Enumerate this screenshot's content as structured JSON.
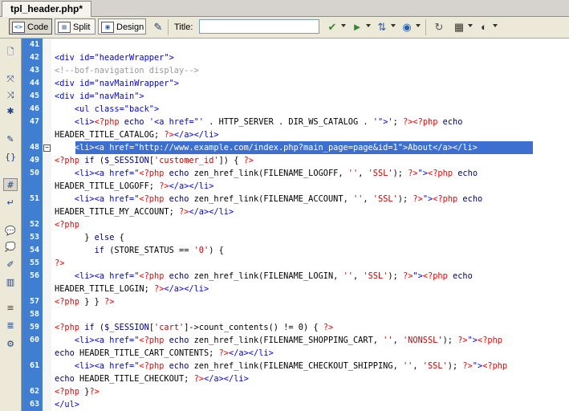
{
  "tab": {
    "label": "tpl_header.php*"
  },
  "toolbar": {
    "code_label": "Code",
    "split_label": "Split",
    "design_label": "Design",
    "title_label": "Title:",
    "title_value": ""
  },
  "lines": [
    {
      "num": "41",
      "parts": []
    },
    {
      "num": "42",
      "parts": [
        {
          "c": "t",
          "t": "<div id=\"headerWrapper\">"
        }
      ]
    },
    {
      "num": "43",
      "parts": [
        {
          "c": "c",
          "t": "<!--bof-navigation display-->"
        }
      ]
    },
    {
      "num": "44",
      "parts": [
        {
          "c": "t",
          "t": "<div id=\"navMainWrapper\">"
        }
      ]
    },
    {
      "num": "45",
      "parts": [
        {
          "c": "t",
          "t": "<div id=\"navMain\">"
        }
      ]
    },
    {
      "num": "46",
      "parts": [
        {
          "c": "t",
          "t": "    <ul class=\"back\">"
        }
      ]
    },
    {
      "num": "47",
      "parts": [
        {
          "c": "t",
          "t": "    <li>"
        },
        {
          "c": "p",
          "t": "<?php"
        },
        {
          "c": "k",
          "t": " echo "
        },
        {
          "c": "t",
          "t": "'<a href=\"'"
        },
        {
          "c": "f",
          "t": " . HTTP_SERVER . DIR_WS_CATALOG . "
        },
        {
          "c": "t",
          "t": "'\">'"
        },
        {
          "c": "f",
          "t": "; "
        },
        {
          "c": "p",
          "t": "?><?php"
        },
        {
          "c": "k",
          "t": " echo"
        }
      ]
    },
    {
      "num": "",
      "parts": [
        {
          "c": "f",
          "t": "HEADER_TITLE_CATALOG; "
        },
        {
          "c": "p",
          "t": "?>"
        },
        {
          "c": "t",
          "t": "</a></li>"
        }
      ]
    },
    {
      "num": "48",
      "hl": true,
      "fold": true,
      "parts": [
        {
          "c": "t",
          "t": "    <li><a href=\"http://www.example.com/index.php?main_page=page&id=1\">About</a></li>"
        }
      ]
    },
    {
      "num": "49",
      "parts": [
        {
          "c": "p",
          "t": "<?php"
        },
        {
          "c": "k",
          "t": " if "
        },
        {
          "c": "f",
          "t": "("
        },
        {
          "c": "var",
          "t": "$_SESSION"
        },
        {
          "c": "f",
          "t": "["
        },
        {
          "c": "q",
          "t": "'customer_id'"
        },
        {
          "c": "f",
          "t": "]) { "
        },
        {
          "c": "p",
          "t": "?>"
        }
      ]
    },
    {
      "num": "50",
      "parts": [
        {
          "c": "t",
          "t": "    <li><a href=\""
        },
        {
          "c": "p",
          "t": "<?php"
        },
        {
          "c": "k",
          "t": " echo "
        },
        {
          "c": "f",
          "t": "zen_href_link(FILENAME_LOGOFF, "
        },
        {
          "c": "q",
          "t": "''"
        },
        {
          "c": "f",
          "t": ", "
        },
        {
          "c": "q",
          "t": "'SSL'"
        },
        {
          "c": "f",
          "t": "); "
        },
        {
          "c": "p",
          "t": "?>"
        },
        {
          "c": "t",
          "t": "\">"
        },
        {
          "c": "p",
          "t": "<?php"
        },
        {
          "c": "k",
          "t": " echo"
        }
      ]
    },
    {
      "num": "",
      "parts": [
        {
          "c": "f",
          "t": "HEADER_TITLE_LOGOFF; "
        },
        {
          "c": "p",
          "t": "?>"
        },
        {
          "c": "t",
          "t": "</a></li>"
        }
      ]
    },
    {
      "num": "51",
      "parts": [
        {
          "c": "t",
          "t": "    <li><a href=\""
        },
        {
          "c": "p",
          "t": "<?php"
        },
        {
          "c": "k",
          "t": " echo "
        },
        {
          "c": "f",
          "t": "zen_href_link(FILENAME_ACCOUNT, "
        },
        {
          "c": "q",
          "t": "''"
        },
        {
          "c": "f",
          "t": ", "
        },
        {
          "c": "q",
          "t": "'SSL'"
        },
        {
          "c": "f",
          "t": "); "
        },
        {
          "c": "p",
          "t": "?>"
        },
        {
          "c": "t",
          "t": "\">"
        },
        {
          "c": "p",
          "t": "<?php"
        },
        {
          "c": "k",
          "t": " echo"
        }
      ]
    },
    {
      "num": "",
      "parts": [
        {
          "c": "f",
          "t": "HEADER_TITLE_MY_ACCOUNT; "
        },
        {
          "c": "p",
          "t": "?>"
        },
        {
          "c": "t",
          "t": "</a></li>"
        }
      ]
    },
    {
      "num": "52",
      "parts": [
        {
          "c": "p",
          "t": "<?php"
        }
      ]
    },
    {
      "num": "53",
      "parts": [
        {
          "c": "f",
          "t": "      } "
        },
        {
          "c": "k",
          "t": "else"
        },
        {
          "c": "f",
          "t": " {"
        }
      ]
    },
    {
      "num": "54",
      "parts": [
        {
          "c": "k",
          "t": "        if "
        },
        {
          "c": "f",
          "t": "(STORE_STATUS == "
        },
        {
          "c": "q",
          "t": "'0'"
        },
        {
          "c": "f",
          "t": ") {"
        }
      ]
    },
    {
      "num": "55",
      "parts": [
        {
          "c": "p",
          "t": "?>"
        }
      ]
    },
    {
      "num": "56",
      "parts": [
        {
          "c": "t",
          "t": "    <li><a href=\""
        },
        {
          "c": "p",
          "t": "<?php"
        },
        {
          "c": "k",
          "t": " echo "
        },
        {
          "c": "f",
          "t": "zen_href_link(FILENAME_LOGIN, "
        },
        {
          "c": "q",
          "t": "''"
        },
        {
          "c": "f",
          "t": ", "
        },
        {
          "c": "q",
          "t": "'SSL'"
        },
        {
          "c": "f",
          "t": "); "
        },
        {
          "c": "p",
          "t": "?>"
        },
        {
          "c": "t",
          "t": "\">"
        },
        {
          "c": "p",
          "t": "<?php"
        },
        {
          "c": "k",
          "t": " echo"
        }
      ]
    },
    {
      "num": "",
      "parts": [
        {
          "c": "f",
          "t": "HEADER_TITLE_LOGIN; "
        },
        {
          "c": "p",
          "t": "?>"
        },
        {
          "c": "t",
          "t": "</a></li>"
        }
      ]
    },
    {
      "num": "57",
      "parts": [
        {
          "c": "p",
          "t": "<?php"
        },
        {
          "c": "f",
          "t": " } } "
        },
        {
          "c": "p",
          "t": "?>"
        }
      ]
    },
    {
      "num": "58",
      "parts": []
    },
    {
      "num": "59",
      "parts": [
        {
          "c": "p",
          "t": "<?php"
        },
        {
          "c": "k",
          "t": " if "
        },
        {
          "c": "f",
          "t": "("
        },
        {
          "c": "var",
          "t": "$_SESSION"
        },
        {
          "c": "f",
          "t": "["
        },
        {
          "c": "q",
          "t": "'cart'"
        },
        {
          "c": "f",
          "t": "]->count_contents() != 0) { "
        },
        {
          "c": "p",
          "t": "?>"
        }
      ]
    },
    {
      "num": "60",
      "parts": [
        {
          "c": "t",
          "t": "    <li><a href=\""
        },
        {
          "c": "p",
          "t": "<?php"
        },
        {
          "c": "k",
          "t": " echo "
        },
        {
          "c": "f",
          "t": "zen_href_link(FILENAME_SHOPPING_CART, "
        },
        {
          "c": "q",
          "t": "''"
        },
        {
          "c": "f",
          "t": ", "
        },
        {
          "c": "q",
          "t": "'NONSSL'"
        },
        {
          "c": "f",
          "t": "); "
        },
        {
          "c": "p",
          "t": "?>"
        },
        {
          "c": "t",
          "t": "\">"
        },
        {
          "c": "p",
          "t": "<?php"
        }
      ]
    },
    {
      "num": "",
      "parts": [
        {
          "c": "k",
          "t": "echo "
        },
        {
          "c": "f",
          "t": "HEADER_TITLE_CART_CONTENTS; "
        },
        {
          "c": "p",
          "t": "?>"
        },
        {
          "c": "t",
          "t": "</a></li>"
        }
      ]
    },
    {
      "num": "61",
      "parts": [
        {
          "c": "t",
          "t": "    <li><a href=\""
        },
        {
          "c": "p",
          "t": "<?php"
        },
        {
          "c": "k",
          "t": " echo "
        },
        {
          "c": "f",
          "t": "zen_href_link(FILENAME_CHECKOUT_SHIPPING, "
        },
        {
          "c": "q",
          "t": "''"
        },
        {
          "c": "f",
          "t": ", "
        },
        {
          "c": "q",
          "t": "'SSL'"
        },
        {
          "c": "f",
          "t": "); "
        },
        {
          "c": "p",
          "t": "?>"
        },
        {
          "c": "t",
          "t": "\">"
        },
        {
          "c": "p",
          "t": "<?php"
        }
      ]
    },
    {
      "num": "",
      "parts": [
        {
          "c": "k",
          "t": "echo "
        },
        {
          "c": "f",
          "t": "HEADER_TITLE_CHECKOUT; "
        },
        {
          "c": "p",
          "t": "?>"
        },
        {
          "c": "t",
          "t": "</a></li>"
        }
      ]
    },
    {
      "num": "62",
      "parts": [
        {
          "c": "p",
          "t": "<?php"
        },
        {
          "c": "f",
          "t": " }"
        },
        {
          "c": "p",
          "t": "?>"
        }
      ]
    },
    {
      "num": "63",
      "parts": [
        {
          "c": "t",
          "t": "</ul>"
        }
      ]
    }
  ],
  "sidebar_icons": [
    "file-icon",
    "expand-icon",
    "collapse-icon",
    "select-icon",
    "outline-icon",
    "brace-icon",
    "line-numbers-icon",
    "wrap-icon",
    "comment-icon",
    "uncomment-icon",
    "snippet-icon",
    "format-icon",
    "indent-icon",
    "outdent-icon",
    "format-source-icon"
  ]
}
